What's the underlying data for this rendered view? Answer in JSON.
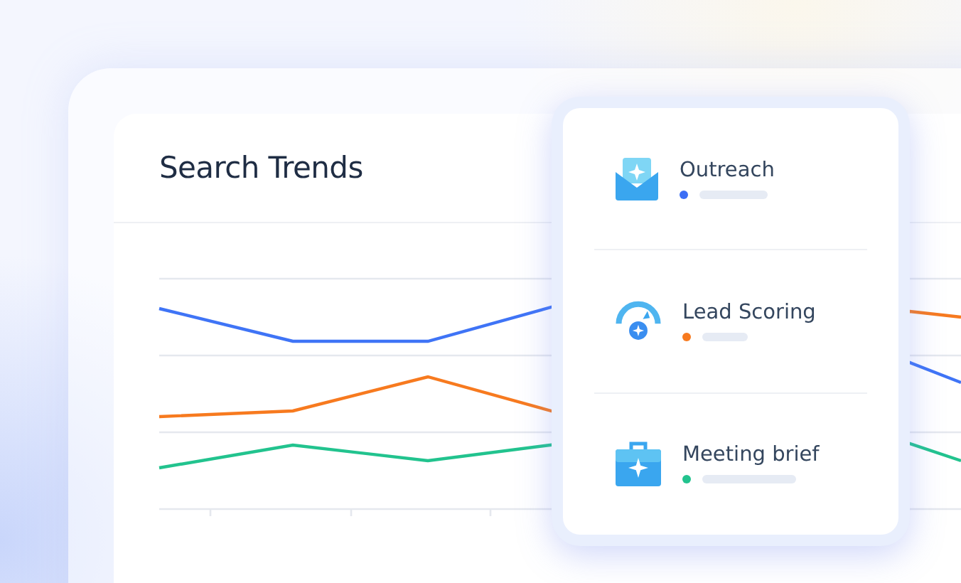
{
  "card": {
    "title": "Search Trends"
  },
  "popup": {
    "items": [
      {
        "label": "Outreach",
        "kind": "envelope",
        "color": "#3b6ef5"
      },
      {
        "label": "Lead Scoring",
        "kind": "gauge",
        "color": "#f77a1f"
      },
      {
        "label": "Meeting brief",
        "kind": "briefcase",
        "color": "#22c38e"
      }
    ]
  }
}
